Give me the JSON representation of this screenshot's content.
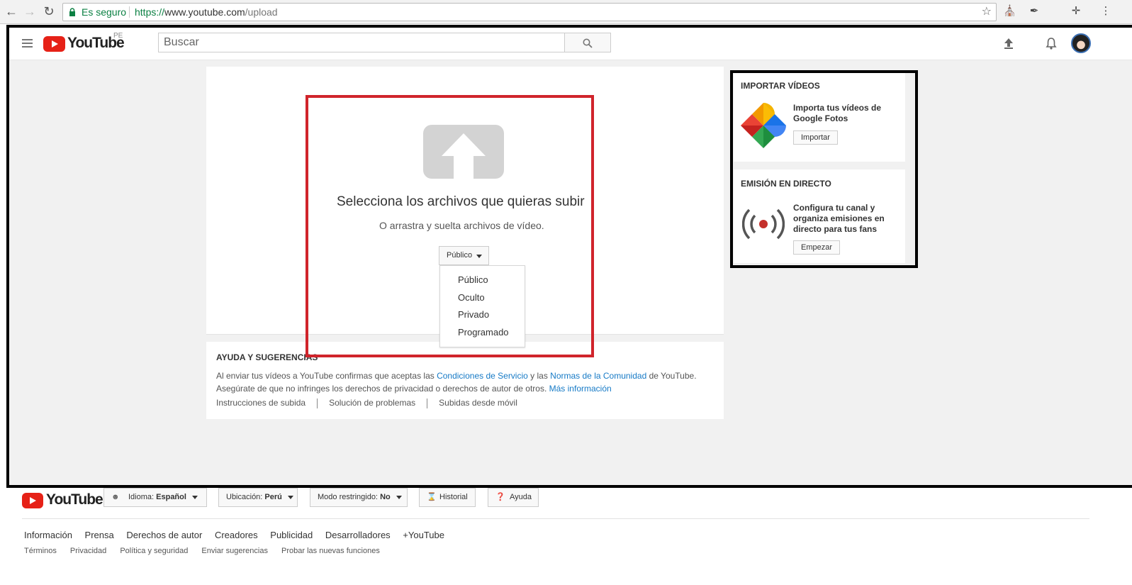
{
  "browser": {
    "secure_label": "Es seguro",
    "url_scheme": "https://",
    "url_host": "www.youtube.com",
    "url_path": "/upload"
  },
  "header": {
    "logo_text": "YouTube",
    "country": "PE",
    "search_placeholder": "Buscar"
  },
  "upload": {
    "title": "Selecciona los archivos que quieras subir",
    "subtitle": "O arrastra y suelta archivos de vídeo.",
    "privacy_selected": "Público",
    "privacy_options": [
      "Público",
      "Oculto",
      "Privado",
      "Programado"
    ]
  },
  "help": {
    "title": "AYUDA Y SUGERENCIAS",
    "text_1": "Al enviar tus vídeos a YouTube confirmas que aceptas las ",
    "link_terms": "Condiciones de Servicio",
    "text_2": " y las ",
    "link_guidelines": "Normas de la Comunidad",
    "text_3": " de YouTube.",
    "text_4": "Asegúrate de que no infringes los derechos de privacidad o derechos de autor de otros. ",
    "link_more": "Más información",
    "links": [
      "Instrucciones de subida",
      "Solución de problemas",
      "Subidas desde móvil"
    ]
  },
  "import_card": {
    "title": "IMPORTAR VÍDEOS",
    "text": "Importa tus vídeos de Google Fotos",
    "button": "Importar"
  },
  "live_card": {
    "title": "EMISIÓN EN DIRECTO",
    "text": "Configura tu canal y organiza emisiones en directo para tus fans",
    "button": "Empezar"
  },
  "footer": {
    "logo_text": "YouTube",
    "language_label": "Idioma:",
    "language_value": "Español",
    "location_label": "Ubicación:",
    "location_value": "Perú",
    "restricted_label": "Modo restringido:",
    "restricted_value": "No",
    "history": "Historial",
    "help": "Ayuda",
    "links_primary": [
      "Información",
      "Prensa",
      "Derechos de autor",
      "Creadores",
      "Publicidad",
      "Desarrolladores",
      "+YouTube"
    ],
    "links_secondary": [
      "Términos",
      "Privacidad",
      "Política y seguridad",
      "Enviar sugerencias",
      "Probar las nuevas funciones"
    ]
  }
}
